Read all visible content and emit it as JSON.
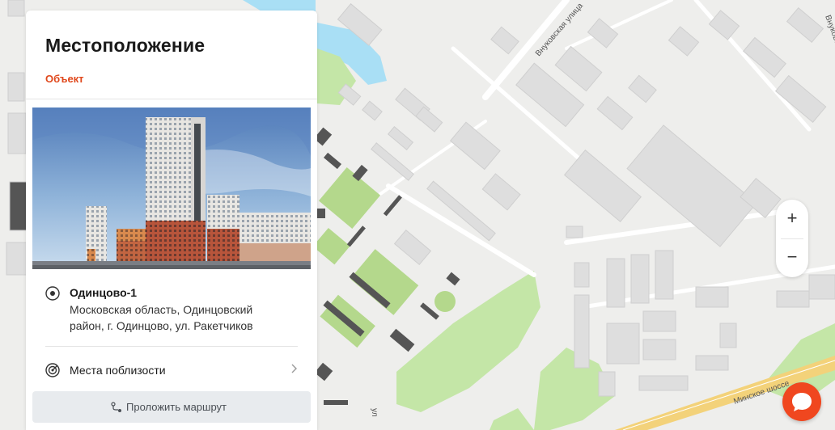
{
  "panel": {
    "title": "Местоположение",
    "subtitle": "Объект",
    "address": {
      "name": "Одинцово-1",
      "line1": "Московская область, Одинцовский",
      "line2": "район, г. Одинцово, ул. Ракетчиков"
    },
    "nearby_label": "Места поблизости",
    "route_label": "Проложить маршрут"
  },
  "map": {
    "road_labels": {
      "vnukovskaya": "Внуковская улица",
      "minskoe": "Минское шоссе",
      "edge": "Внуковская",
      "bottom_frag": "ул"
    },
    "zoom_in": "+",
    "zoom_out": "−"
  },
  "colors": {
    "accent": "#e0481c",
    "chat": "#f0471f",
    "park": "#c4e6a7",
    "field": "#b4d88c",
    "water": "#a9dff5",
    "highway": "#f3d27a"
  },
  "icons": [
    "location-pin-icon",
    "target-radar-icon",
    "chevron-right-icon",
    "route-icon",
    "chat-bubble-icon"
  ]
}
